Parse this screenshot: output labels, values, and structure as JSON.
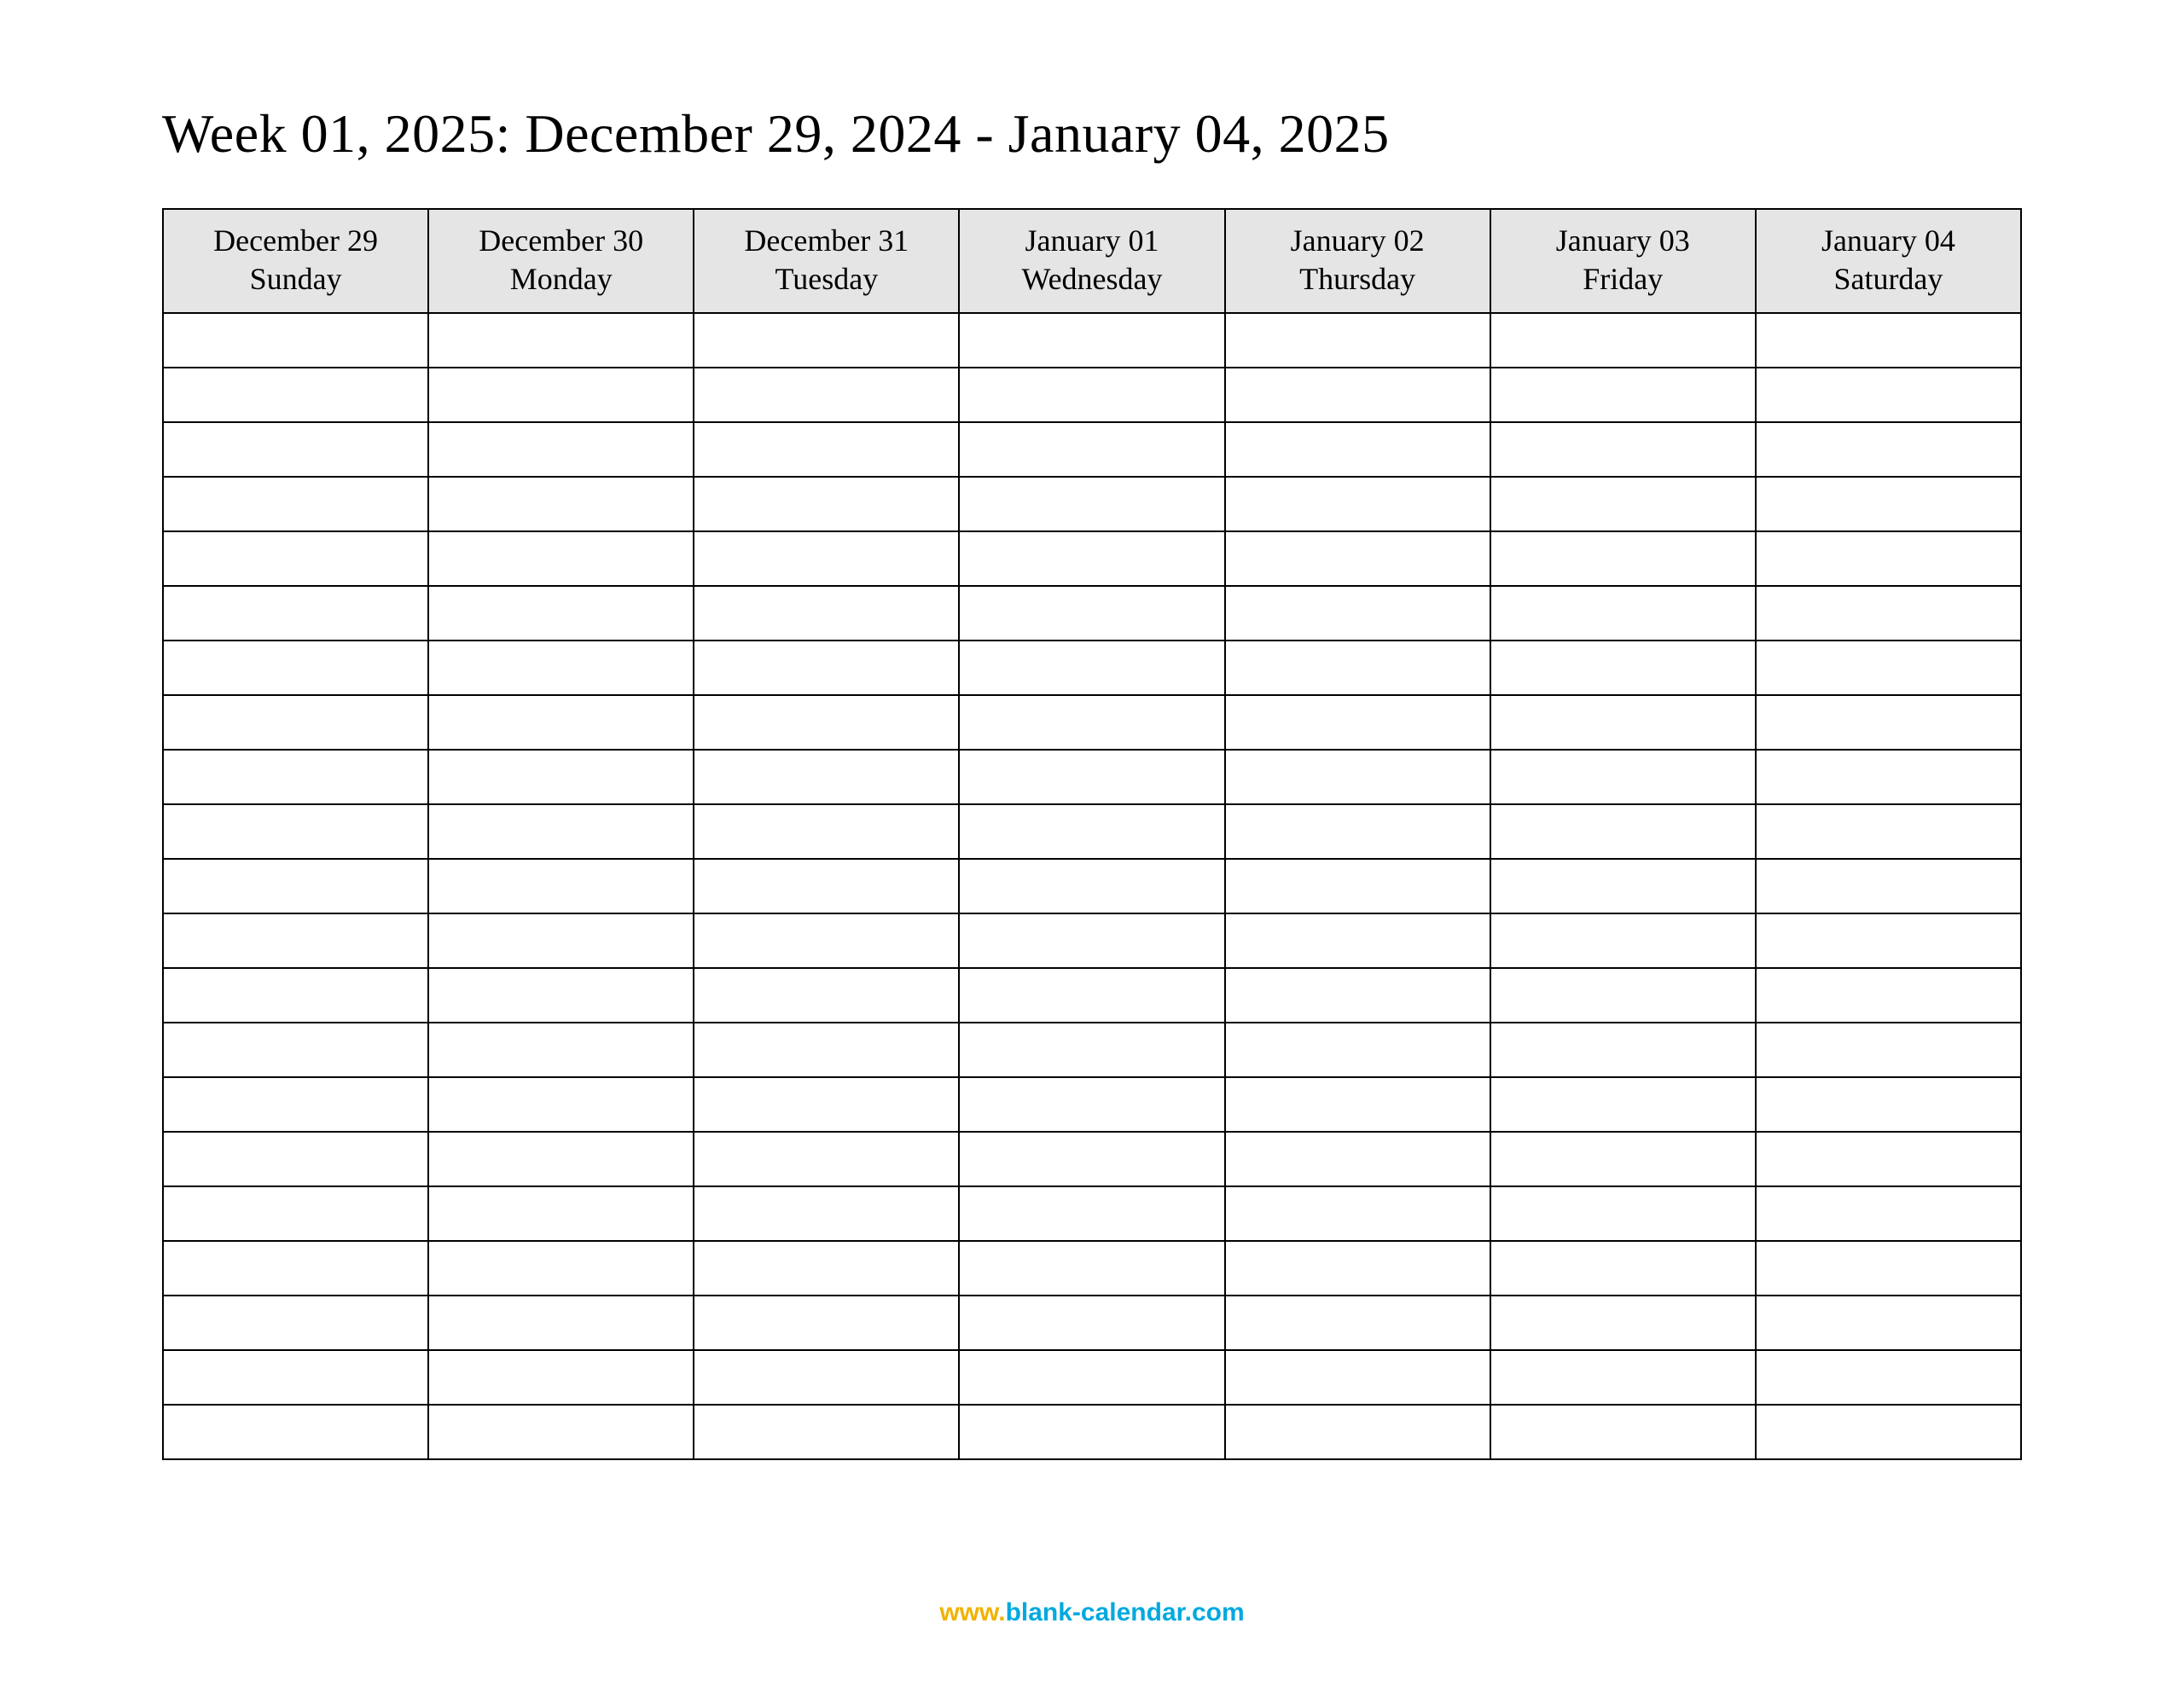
{
  "title": "Week 01, 2025: December 29, 2024 - January 04, 2025",
  "columns": [
    {
      "date": "December 29",
      "day": "Sunday"
    },
    {
      "date": "December 30",
      "day": "Monday"
    },
    {
      "date": "December 31",
      "day": "Tuesday"
    },
    {
      "date": "January 01",
      "day": "Wednesday"
    },
    {
      "date": "January 02",
      "day": "Thursday"
    },
    {
      "date": "January 03",
      "day": "Friday"
    },
    {
      "date": "January 04",
      "day": "Saturday"
    }
  ],
  "blank_row_count": 21,
  "footer": {
    "prefix": "www.",
    "rest": "blank-calendar.com"
  }
}
